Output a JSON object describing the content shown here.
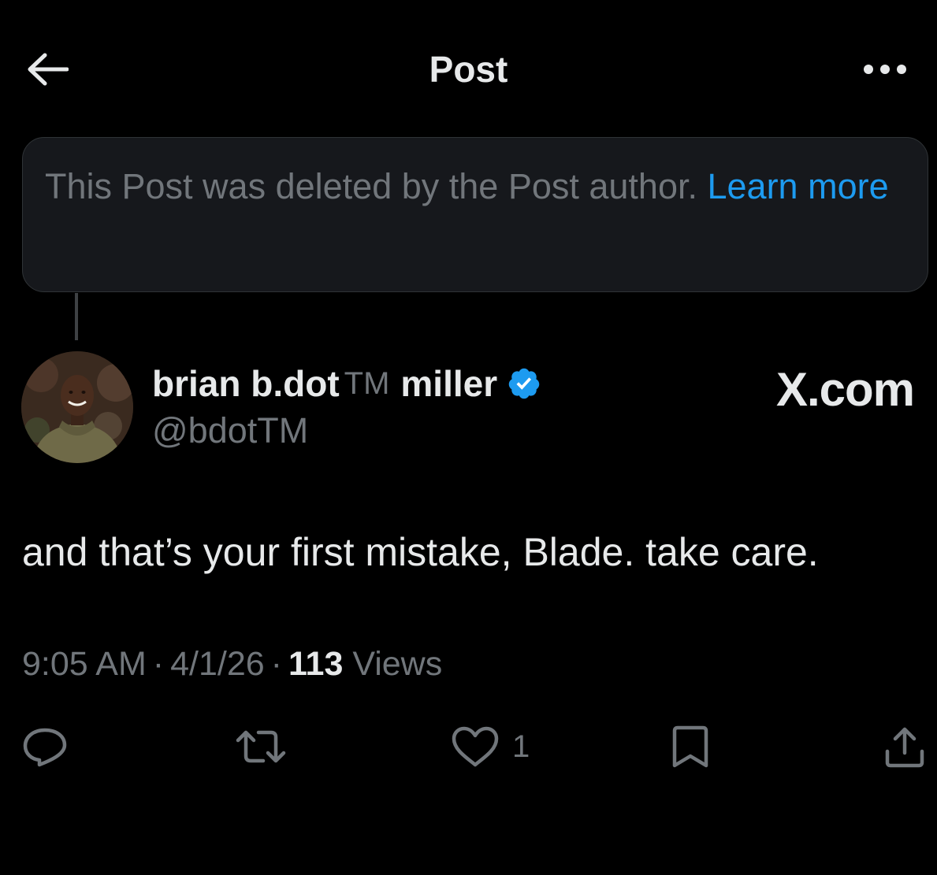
{
  "header": {
    "title": "Post",
    "back_icon": "arrow-left-icon",
    "more_icon": "more-horizontal-icon"
  },
  "notice": {
    "text": "This Post was deleted by the Post author. ",
    "link": "Learn more"
  },
  "author": {
    "name_first": "brian b.dot",
    "name_tm": "TM",
    "name_last": "miller",
    "handle": "@bdotTM",
    "verified": true
  },
  "watermark": "X.com",
  "post": {
    "text": "and that’s your first mistake, Blade. take care."
  },
  "meta": {
    "time": "9:05 AM",
    "date": "4/1/26",
    "separator": "·",
    "views_count": "113",
    "views_label": "Views"
  },
  "actions": {
    "reply_icon": "reply-icon",
    "repost_icon": "repost-icon",
    "like_icon": "heart-icon",
    "like_count": "1",
    "bookmark_icon": "bookmark-icon",
    "share_icon": "share-icon"
  },
  "colors": {
    "background": "#000000",
    "text": "#e7e9ea",
    "muted": "#71767b",
    "accent": "#1d9bf0",
    "card": "#16181c",
    "border": "#2f3336"
  }
}
